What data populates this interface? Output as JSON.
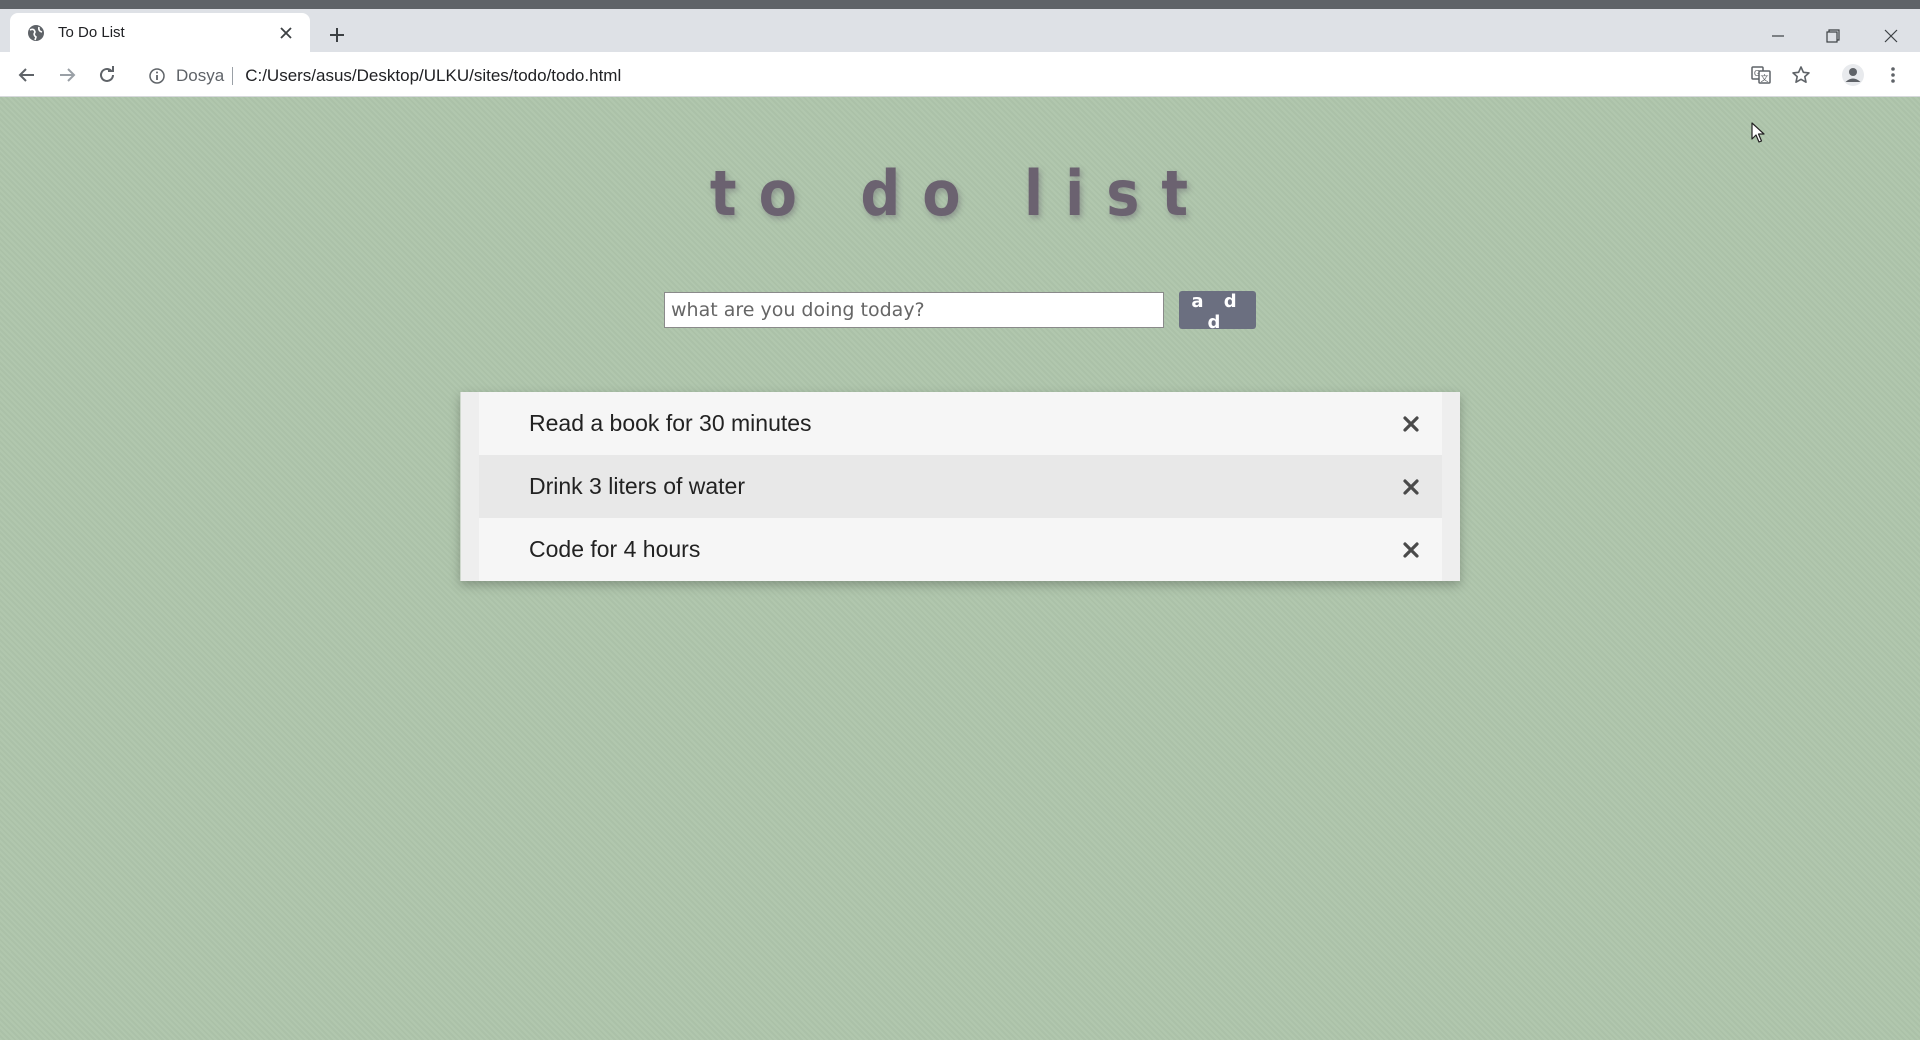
{
  "browser": {
    "tab_title": "To Do List",
    "site_label": "Dosya",
    "url": "C:/Users/asus/Desktop/ULKU/sites/todo/todo.html"
  },
  "app": {
    "title": "to do list",
    "input_placeholder": "what are you doing today?",
    "add_label": "a d d",
    "todos": [
      {
        "text": "Read a book for 30 minutes"
      },
      {
        "text": "Drink 3 liters of water"
      },
      {
        "text": "Code for 4 hours"
      }
    ]
  },
  "colors": {
    "background": "#aec5ab",
    "title": "#6b6270",
    "add_button": "#6b6f80"
  }
}
